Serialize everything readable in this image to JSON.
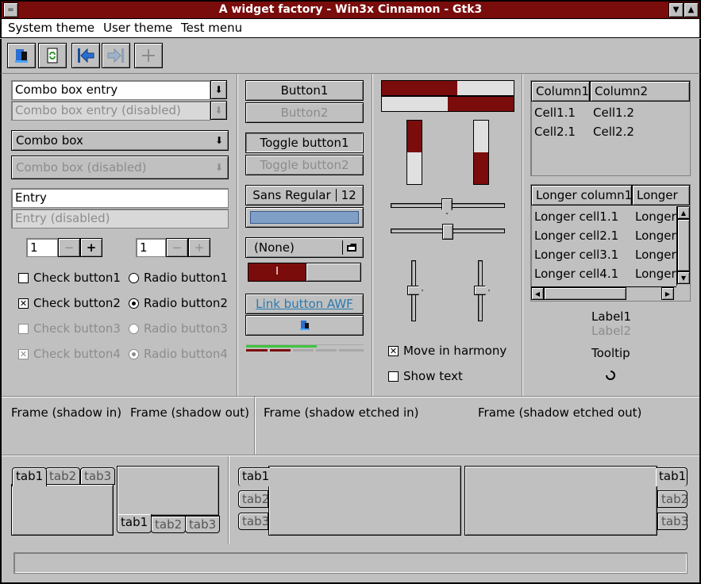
{
  "window": {
    "title": "A widget factory - Win3x Cinnamon - Gtk3",
    "menu_icon": "=",
    "minimize_icon": "▼",
    "maximize_icon": "▲"
  },
  "menu": {
    "items": [
      "System theme",
      "User theme",
      "Test menu"
    ]
  },
  "toolbar": {
    "icons": [
      "open-icon",
      "refresh-icon",
      "back-icon",
      "forward-icon",
      "add-icon"
    ]
  },
  "col1": {
    "combo_entry": "Combo box entry",
    "combo_entry_disabled": "Combo box entry (disabled)",
    "combo": "Combo box",
    "combo_disabled": "Combo box (disabled)",
    "entry": "Entry",
    "entry_disabled": "Entry (disabled)",
    "spin1_value": "1",
    "spin2_value": "1",
    "minus": "−",
    "plus": "+",
    "check1": "Check button1",
    "check2": "Check button2",
    "check3": "Check button3",
    "check4": "Check button4",
    "radio1": "Radio button1",
    "radio2": "Radio button2",
    "radio3": "Radio button3",
    "radio4": "Radio button4",
    "check_mark": "✕"
  },
  "col2": {
    "button1": "Button1",
    "button2": "Button2",
    "toggle1": "Toggle button1",
    "toggle2": "Toggle button2",
    "font_name": "Sans Regular",
    "font_size": "12",
    "file_chooser": "(None)",
    "switch_on_label": "I",
    "link": "Link button AWF",
    "level_bar_fraction": 0.6
  },
  "col3": {
    "progress_h1": 0.57,
    "progress_h2": 0.5,
    "progress_v1": 0.5,
    "progress_v2": 0.5,
    "move_in_harmony": "Move in harmony",
    "show_text": "Show text"
  },
  "col4": {
    "tree1_headers": [
      "Column1",
      "Column2"
    ],
    "tree1_rows": [
      [
        "Cell1.1",
        "Cell1.2"
      ],
      [
        "Cell2.1",
        "Cell2.2"
      ]
    ],
    "tree2_headers": [
      "Longer column1",
      "Longer"
    ],
    "tree2_rows": [
      [
        "Longer cell1.1",
        "Longer"
      ],
      [
        "Longer cell2.1",
        "Longer"
      ],
      [
        "Longer cell3.1",
        "Longer"
      ],
      [
        "Longer cell4.1",
        "Longer"
      ]
    ],
    "label1": "Label1",
    "label2": "Label2",
    "tooltip": "Tooltip"
  },
  "frames": {
    "shadow_in": "Frame (shadow in)",
    "shadow_out": "Frame (shadow out)",
    "etched_in": "Frame (shadow etched in)",
    "etched_out": "Frame (shadow etched out)"
  },
  "tabs": {
    "labels": [
      "tab1",
      "tab2",
      "tab3"
    ]
  },
  "colors": {
    "accent": "#7a0c0c",
    "face": "#c0c0c0",
    "link": "#2a7ab0",
    "progress_green": "#3ec43e",
    "entry_selected": "#7f9fc7"
  }
}
